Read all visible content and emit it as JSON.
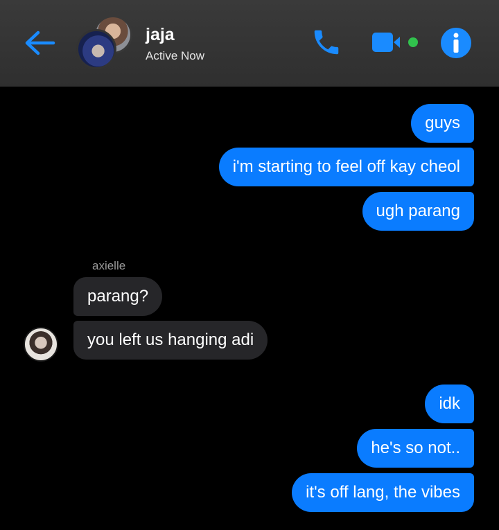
{
  "header": {
    "contact_name": "jaja",
    "status": "Active Now",
    "colors": {
      "accent": "#1a8bff",
      "online": "#31c24d"
    }
  },
  "icons": {
    "back": "arrow-left",
    "phone": "phone",
    "video": "video-camera",
    "info": "info-circle"
  },
  "messages": [
    {
      "from": "me",
      "text": "guys"
    },
    {
      "from": "me",
      "text": "i'm starting to feel off kay cheol"
    },
    {
      "from": "me",
      "text": "ugh parang"
    },
    {
      "from": "axielle",
      "sender_label": "axielle",
      "text": "parang?"
    },
    {
      "from": "axielle",
      "text": "you left us hanging adi"
    },
    {
      "from": "me",
      "text": "idk"
    },
    {
      "from": "me",
      "text": "he's so not.."
    },
    {
      "from": "me",
      "text": "it's off lang, the vibes"
    }
  ]
}
